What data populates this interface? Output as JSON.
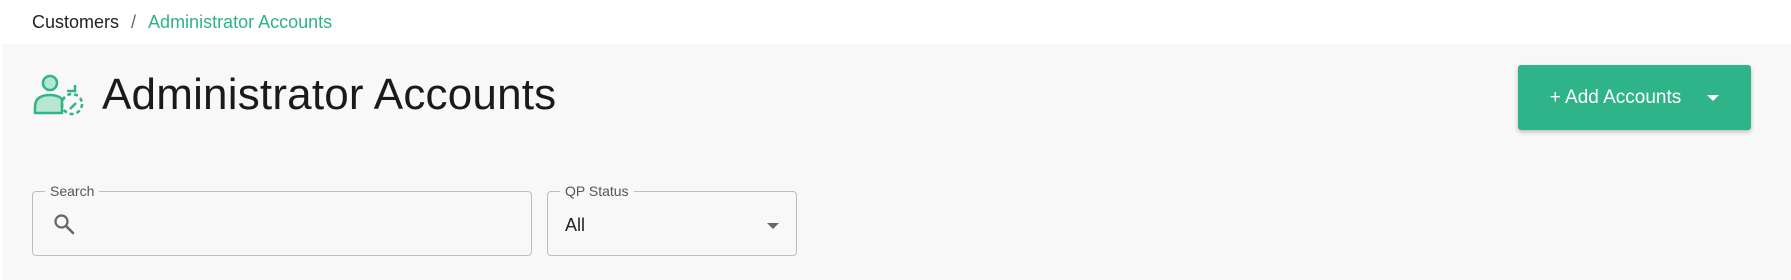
{
  "breadcrumb": {
    "parent": "Customers",
    "separator": "/",
    "current": "Administrator Accounts"
  },
  "header": {
    "title": "Administrator Accounts",
    "icon": "user-settings-icon"
  },
  "actions": {
    "add_label": "+ Add Accounts",
    "add_icon": "chevron-down-icon"
  },
  "filters": {
    "search": {
      "label": "Search",
      "value": "",
      "placeholder": ""
    },
    "qp_status": {
      "label": "QP Status",
      "value": "All"
    }
  },
  "colors": {
    "accent": "#2fb489",
    "breadcrumb_active": "#2db38a",
    "background": "#f8f8f8"
  }
}
